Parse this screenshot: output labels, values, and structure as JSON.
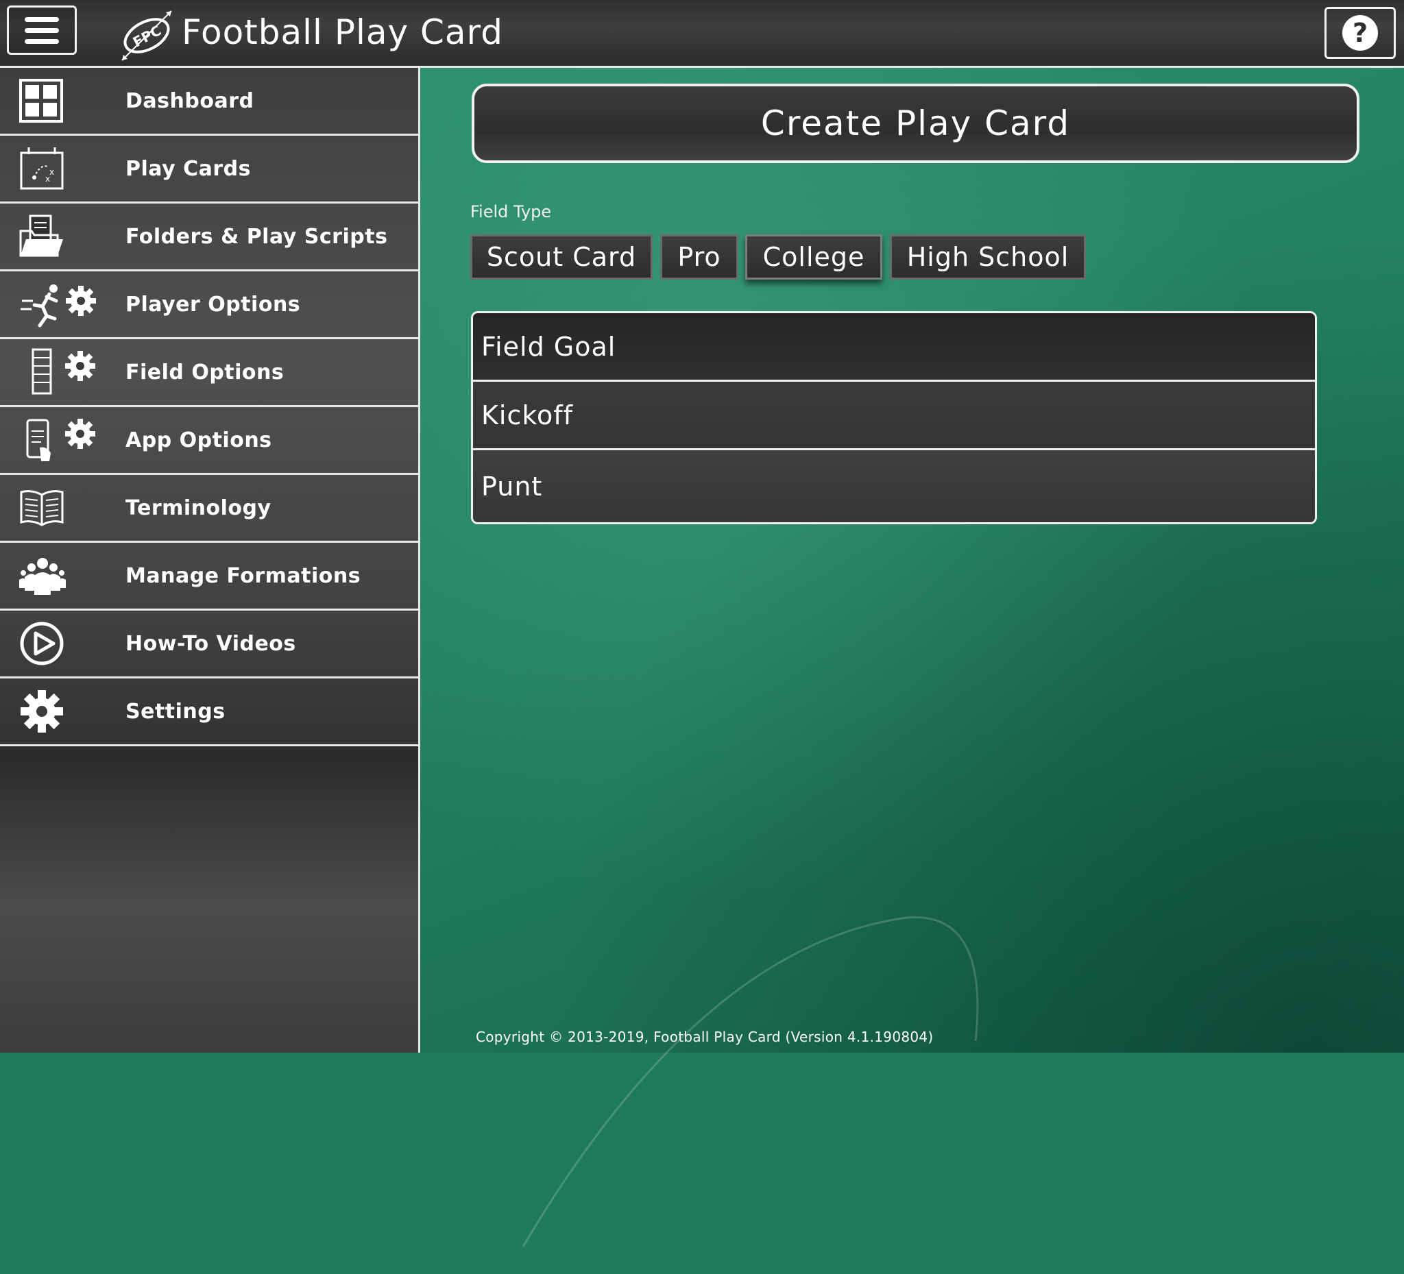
{
  "header": {
    "app_title": "Football Play Card",
    "logo_text": "FPC"
  },
  "sidebar": {
    "items": [
      {
        "label": "Dashboard",
        "icon": "dashboard-icon"
      },
      {
        "label": "Play Cards",
        "icon": "play-cards-icon"
      },
      {
        "label": "Folders & Play Scripts",
        "icon": "folder-icon"
      },
      {
        "label": "Player Options",
        "icon": "player-options-icon"
      },
      {
        "label": "Field Options",
        "icon": "field-options-icon"
      },
      {
        "label": "App Options",
        "icon": "app-options-icon"
      },
      {
        "label": "Terminology",
        "icon": "book-icon"
      },
      {
        "label": "Manage Formations",
        "icon": "group-icon"
      },
      {
        "label": "How-To Videos",
        "icon": "play-circle-icon"
      },
      {
        "label": "Settings",
        "icon": "gear-icon"
      }
    ]
  },
  "main": {
    "create_button": "Create Play Card",
    "field_type_label": "Field Type",
    "field_types": [
      {
        "label": "Scout Card",
        "selected": false
      },
      {
        "label": "Pro",
        "selected": false
      },
      {
        "label": "College",
        "selected": true
      },
      {
        "label": "High School",
        "selected": false
      }
    ],
    "options": [
      "Field Goal",
      "Kickoff",
      "Punt"
    ],
    "copyright": "Copyright © 2013-2019, Football Play Card (Version 4.1.190804)"
  },
  "colors": {
    "field_green": "#238061",
    "panel_dark": "#333534",
    "border_light": "#f0f0f0"
  }
}
